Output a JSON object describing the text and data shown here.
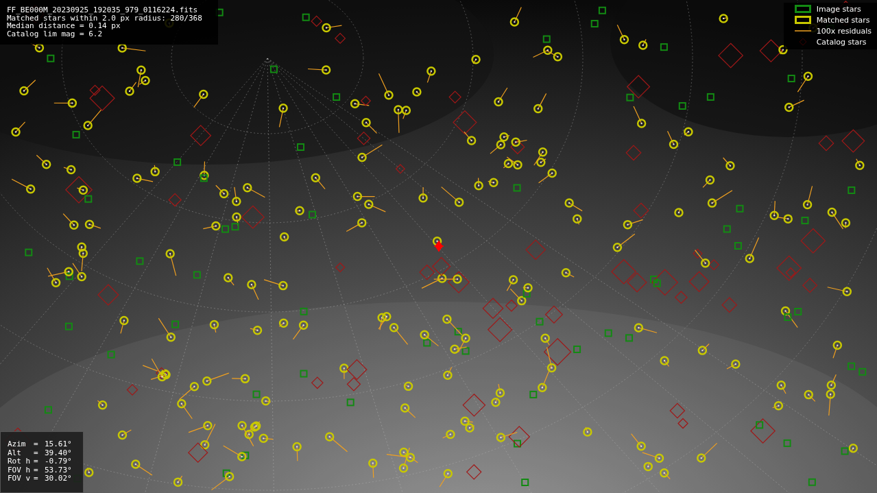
{
  "info_panel": {
    "lines": [
      "FF_BE000M_20230925_192035_979_0116224.fits",
      "Matched stars within 2.0 px radius: 280/368",
      "Median distance = 0.14 px",
      "Catalog lim mag = 6.2"
    ]
  },
  "legend": [
    {
      "label": "Image stars"
    },
    {
      "label": "Matched stars",
      "kind": "matched"
    },
    {
      "label": "100x residuals",
      "kind": "residual"
    },
    {
      "label": "Catalog stars",
      "kind": "catalog"
    }
  ],
  "pointing_panel": {
    "rows": [
      {
        "label": "Azim",
        "sep": "=",
        "value": "15.61°"
      },
      {
        "label": "Alt",
        "sep": "=",
        "value": "39.40°"
      },
      {
        "label": "Rot h",
        "sep": "=",
        "value": "-0.79°"
      },
      {
        "label": "FOV h",
        "sep": "=",
        "value": "53.73°"
      },
      {
        "label": "FOV v",
        "sep": "=",
        "value": "30.02°"
      }
    ]
  }
}
